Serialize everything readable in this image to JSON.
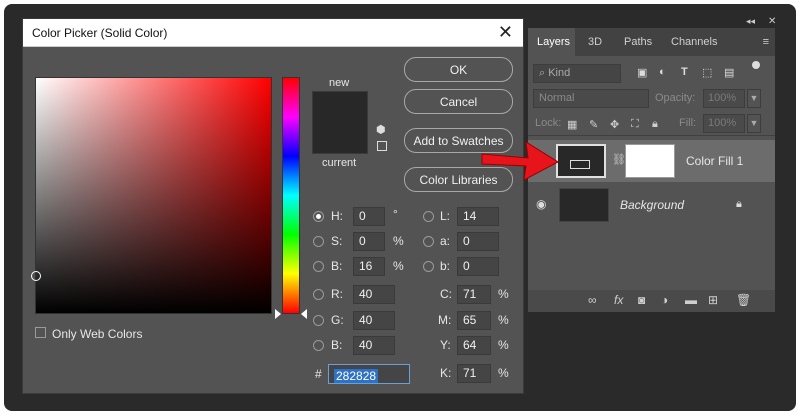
{
  "dialog": {
    "title": "Color Picker (Solid Color)",
    "close": "✕",
    "new_label": "new",
    "current_label": "current",
    "buttons": {
      "ok": "OK",
      "cancel": "Cancel",
      "add": "Add to Swatches",
      "libraries": "Color Libraries"
    },
    "hsb": [
      {
        "label": "H:",
        "value": "0",
        "unit": "°"
      },
      {
        "label": "S:",
        "value": "0",
        "unit": "%"
      },
      {
        "label": "B:",
        "value": "16",
        "unit": "%"
      }
    ],
    "rgb": [
      {
        "label": "R:",
        "value": "40"
      },
      {
        "label": "G:",
        "value": "40"
      },
      {
        "label": "B:",
        "value": "40"
      }
    ],
    "lab": [
      {
        "label": "L:",
        "value": "14"
      },
      {
        "label": "a:",
        "value": "0"
      },
      {
        "label": "b:",
        "value": "0"
      }
    ],
    "cmyk": [
      {
        "label": "C:",
        "value": "71",
        "unit": "%"
      },
      {
        "label": "M:",
        "value": "65",
        "unit": "%"
      },
      {
        "label": "Y:",
        "value": "64",
        "unit": "%"
      },
      {
        "label": "K:",
        "value": "71",
        "unit": "%"
      }
    ],
    "hex_prefix": "#",
    "hex": "282828",
    "only_web": "Only Web Colors",
    "swatch_color": "#282828"
  },
  "layers": {
    "tabs": [
      "Layers",
      "3D",
      "Paths",
      "Channels"
    ],
    "kind": "Kind",
    "blend": "Normal",
    "opacity_label": "Opacity:",
    "opacity": "100%",
    "lock_label": "Lock:",
    "fill_label": "Fill:",
    "fill": "100%",
    "items": [
      {
        "name": "Color Fill 1"
      },
      {
        "name": "Background"
      }
    ]
  }
}
